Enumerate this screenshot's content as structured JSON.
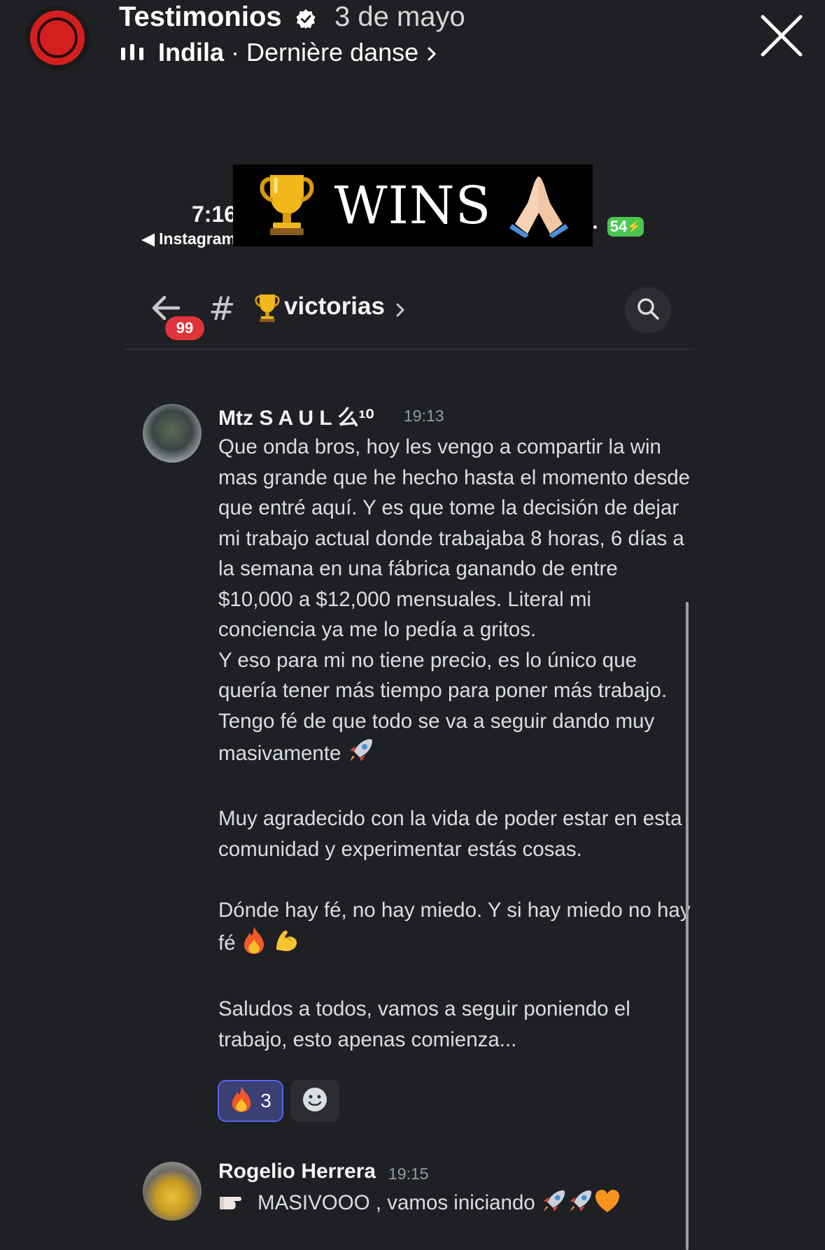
{
  "story": {
    "account_name": "Testimonios",
    "date": "3 de mayo",
    "music_artist": "Indila",
    "music_separator": " · ",
    "music_track": "Dernière danse",
    "close_icon": "close-icon"
  },
  "overlay": {
    "banner_text": "WINS",
    "phone_time": "7:16",
    "phone_back_label": "◀ Instagram",
    "battery": "54"
  },
  "channel": {
    "unread_count": "99",
    "hash": "#",
    "name": "victorias"
  },
  "messages": [
    {
      "author": "Mtz S A U L 么¹⁰",
      "time": "19:13",
      "paragraphs": [
        "Que onda bros, hoy les vengo a compartir la win mas grande que he hecho hasta el momento desde que entré aquí. Y es que tome la decisión de dejar mi trabajo actual donde trabajaba 8 horas, 6 días a la semana en una fábrica ganando de entre $10,000 a $12,000 mensuales. Literal mi conciencia ya me lo pedía a gritos.",
        "Y eso para mi no tiene precio, es lo único que quería tener más tiempo para poner más trabajo. Tengo fé de que todo se va a seguir dando muy masivamente",
        "Muy agradecido con la vida de poder estar en esta comunidad y experimentar estás cosas.",
        "Dónde hay fé, no hay miedo. Y si hay miedo no hay fé",
        "Saludos a todos, vamos a seguir poniendo el trabajo, esto apenas comienza..."
      ],
      "reaction_count": "3"
    },
    {
      "author": "Rogelio Herrera",
      "time": "19:15",
      "text": "MASIVOOO , vamos iniciando"
    }
  ],
  "colors": {
    "background": "#1f2023",
    "accent_blurple": "#5865f2",
    "badge_red": "#e0343c",
    "battery_green": "#4cc652"
  }
}
